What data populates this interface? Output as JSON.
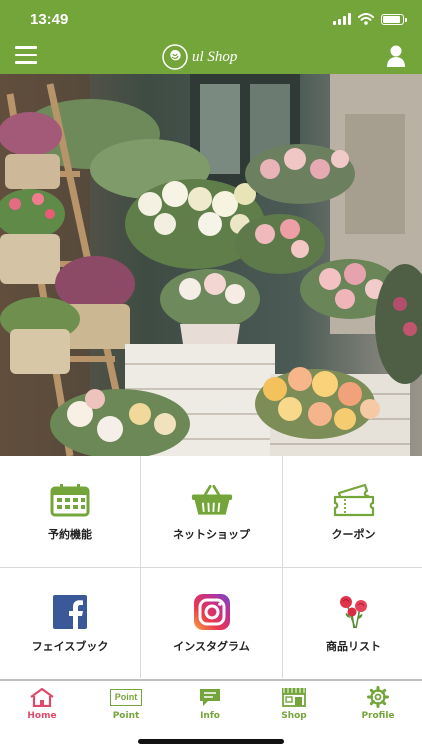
{
  "status_bar": {
    "time": "13:49"
  },
  "header": {
    "logo_text": "ul Shop"
  },
  "tiles": [
    {
      "label": "予約機能",
      "icon": "calendar-icon"
    },
    {
      "label": "ネットショップ",
      "icon": "basket-icon"
    },
    {
      "label": "クーポン",
      "icon": "coupon-icon"
    },
    {
      "label": "フェイスブック",
      "icon": "facebook-icon"
    },
    {
      "label": "インスタグラム",
      "icon": "instagram-icon"
    },
    {
      "label": "商品リスト",
      "icon": "roses-icon"
    }
  ],
  "bottom_nav": [
    {
      "label": "Home",
      "icon": "home-icon",
      "active": true
    },
    {
      "label": "Point",
      "icon": "point-box-icon",
      "icon_text": "Point"
    },
    {
      "label": "Info",
      "icon": "chat-icon"
    },
    {
      "label": "Shop",
      "icon": "shop-icon"
    },
    {
      "label": "Profile",
      "icon": "gear-icon"
    }
  ],
  "colors": {
    "brand_green": "#74a53a",
    "active_pink": "#e04a6a",
    "facebook_blue": "#3b5998"
  }
}
